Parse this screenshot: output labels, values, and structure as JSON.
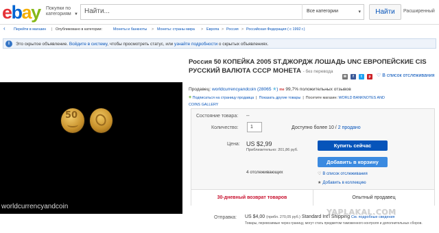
{
  "header": {
    "logo_letters": [
      "e",
      "b",
      "a",
      "y"
    ],
    "shop_by_category": [
      "Покупки по",
      "категориям"
    ],
    "search_placeholder": "Найти...",
    "category_select": "Все категории",
    "search_button": "Найти",
    "advanced": "Расширенный"
  },
  "breadcrumb": {
    "back_label": "Перейти в магазин",
    "listed_in": "Опубликовано в категории:",
    "items": [
      "Монеты и банкноты",
      "Монеты: страны мира",
      "Европа",
      "Россия",
      "Российская Федерация ( с 1992 г.)"
    ],
    "separator": ">"
  },
  "notice": {
    "icon": "i",
    "text1": "Это скрытое объявление.",
    "link1": "Войдите в систему",
    "text2": ", чтобы просмотреть статус, или",
    "link2": "узнайте подробности",
    "text3": " о скрытых объявлениях."
  },
  "image": {
    "watermark": "worldcurrencyandcoin",
    "coin_value": "50"
  },
  "listing": {
    "title": "Россия 50 КОПЕЙКА 2005 ST.ДЖОРДЖ ЛОШАДЬ UNC ЕВРОПЕЙСКИЕ CIS РУССКИЙ ВАЛЮТА СССР МОНЕТА",
    "title_suffix": "- без перевода",
    "share_icons": [
      "✉",
      "f",
      "t",
      "p"
    ],
    "watch_label": "В список отслеживания"
  },
  "seller": {
    "label": "Продавец:",
    "name": "worldcurrencyandcoin",
    "feedback_count": "(28065",
    "star": "✭",
    "feedback_close": ")",
    "me_badge": "me",
    "positive": "99,7% положительных отзывов",
    "subscribe": "Подписаться на страницу продавца",
    "other_items": "Показать другие товары",
    "visit_store_label": "Посетите магазин:",
    "store_name": "WORLD BANKNOTES AND",
    "store_name_2": "COINS GALLERY"
  },
  "purchase": {
    "condition_label": "Состояние товара:",
    "condition_value": "--",
    "quantity_label": "Количество:",
    "quantity_value": "1",
    "availability": "Доступно более 10",
    "sold": "2 продано",
    "price_label": "Цена:",
    "price": "US $2,99",
    "approx": "Приблизительно: 201,86 руб.",
    "buy_now": "Купить сейчас",
    "add_to_cart": "Добавить в корзину",
    "watchers": "4 отслеживающих",
    "watch_link": "В список отслеживания",
    "add_collection": "Добавить в коллекцию",
    "returns": "30-дневный возврат товаров",
    "experienced": "Опытный продавец"
  },
  "shipping": {
    "label": "Отправка:",
    "price": "US $4,00",
    "approx": "(прибл. 270,05 руб.)",
    "method": "Standard Int'l Shipping",
    "see_details": "См. подробные сведения",
    "note": "Товары, перевозимые через границу, могут стать предметом таможенного контроля и дополнительных сборов."
  },
  "site_watermark": "YAPLAKAL.COM",
  "colors": {
    "ebay_red": "#e53238",
    "ebay_blue": "#0654ba",
    "ebay_yellow": "#f5af02",
    "ebay_green": "#86b817"
  }
}
